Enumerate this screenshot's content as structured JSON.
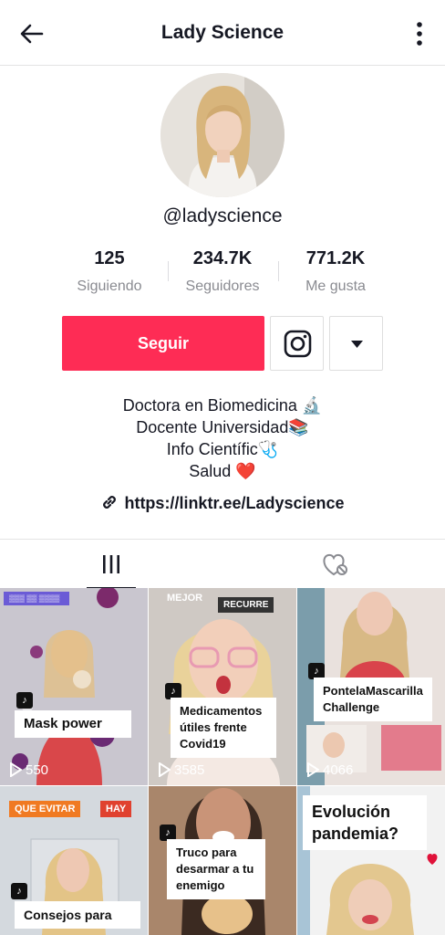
{
  "header": {
    "title": "Lady Science",
    "back_icon": "arrow-left-icon",
    "more_icon": "more-vertical-icon"
  },
  "profile": {
    "username": "@ladyscience",
    "stats": [
      {
        "value": "125",
        "label": "Siguiendo"
      },
      {
        "value": "234.7K",
        "label": "Seguidores"
      },
      {
        "value": "771.2K",
        "label": "Me gusta"
      }
    ],
    "follow_label": "Seguir",
    "bio": [
      "Doctora en Biomedicina 🔬",
      "Docente Universidad📚",
      "Info Científic🩺",
      "Salud ❤️"
    ],
    "link": "https://linktr.ee/Ladyscience"
  },
  "tabs": [
    {
      "icon": "videos-grid-icon",
      "active": true
    },
    {
      "icon": "liked-heart-icon",
      "active": false
    }
  ],
  "videos": [
    {
      "caption": "Mask power",
      "views": "550"
    },
    {
      "caption": "Medicamentos útiles frente Covid19",
      "views": "3585",
      "tag_left": "MEJOR",
      "tag_right": "RECURRE"
    },
    {
      "caption": "PontelaMascarilla Challenge",
      "views": "4066"
    },
    {
      "caption": "Consejos para",
      "tag_left": "QUE EVITAR",
      "tag_right": "HAY"
    },
    {
      "caption": "Truco para desarmar a tu enemigo"
    },
    {
      "caption": "Evolución pandemia?"
    }
  ],
  "colors": {
    "accent": "#fe2c55",
    "text": "#161823",
    "muted": "#8a8b91"
  }
}
